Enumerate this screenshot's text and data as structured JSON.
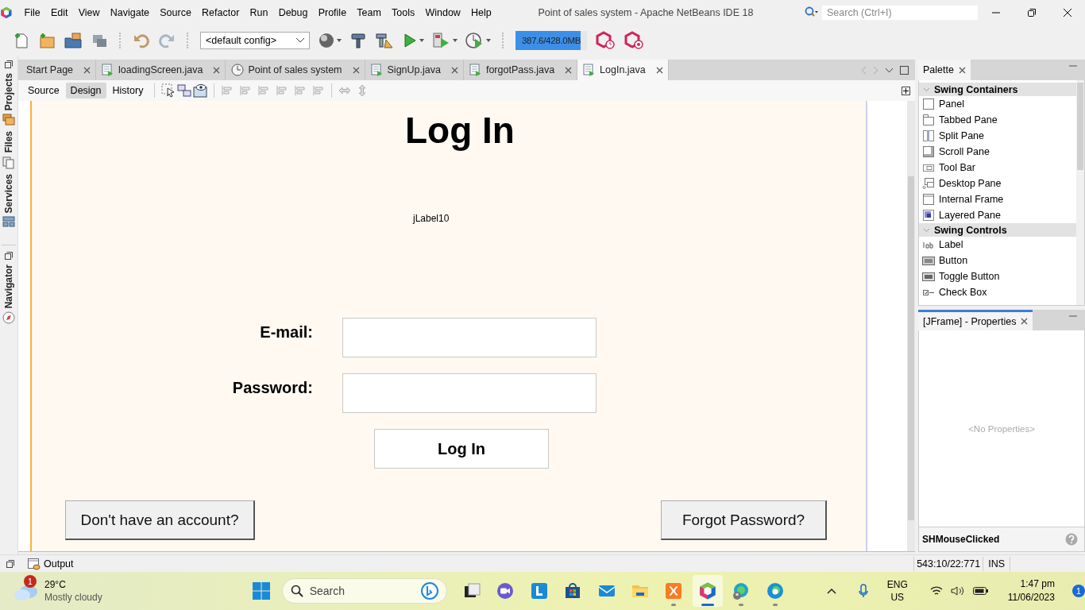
{
  "window": {
    "title": "Point of sales system - Apache NetBeans IDE 18"
  },
  "menu": [
    "File",
    "Edit",
    "View",
    "Navigate",
    "Source",
    "Refactor",
    "Run",
    "Debug",
    "Profile",
    "Team",
    "Tools",
    "Window",
    "Help"
  ],
  "quick_search": {
    "placeholder": "Search (Ctrl+I)"
  },
  "toolbar": {
    "config": "<default config>",
    "memory": {
      "text": "387.6/428.0MB",
      "level": 0.91
    }
  },
  "side_tabs": [
    {
      "label": "Projects",
      "kind": "projects"
    },
    {
      "label": "Files",
      "kind": "files"
    },
    {
      "label": "Services",
      "kind": "services"
    },
    {
      "label": "Navigator",
      "kind": "navigator"
    }
  ],
  "editor_tabs": [
    {
      "label": "Start Page",
      "kind": "page",
      "selected": false
    },
    {
      "label": "loadingScreen.java",
      "kind": "java",
      "selected": false
    },
    {
      "label": "Point of sales system",
      "kind": "clock",
      "selected": false
    },
    {
      "label": "SignUp.java",
      "kind": "java",
      "selected": false
    },
    {
      "label": "forgotPass.java",
      "kind": "java",
      "selected": false
    },
    {
      "label": "LogIn.java",
      "kind": "java",
      "selected": true
    }
  ],
  "view_tabs": [
    {
      "label": "Source",
      "selected": false
    },
    {
      "label": "Design",
      "selected": true
    },
    {
      "label": "History",
      "selected": false
    }
  ],
  "form": {
    "title": "Log In",
    "label": "jLabel10",
    "fields": [
      {
        "label": "E-mail:"
      },
      {
        "label": "Password:"
      }
    ],
    "submit": "Log In",
    "links": [
      "Don't have an account?",
      "Forgot Password?"
    ]
  },
  "palette": {
    "title": "Palette",
    "sections": [
      {
        "title": "Swing Containers",
        "expanded": true,
        "items": [
          {
            "label": "Panel",
            "kind": "panel"
          },
          {
            "label": "Tabbed Pane",
            "kind": "tabbed"
          },
          {
            "label": "Split Pane",
            "kind": "split"
          },
          {
            "label": "Scroll Pane",
            "kind": "scroll"
          },
          {
            "label": "Tool Bar",
            "kind": "toolbar"
          },
          {
            "label": "Desktop Pane",
            "kind": "desktop"
          },
          {
            "label": "Internal Frame",
            "kind": "frame"
          },
          {
            "label": "Layered Pane",
            "kind": "layered"
          }
        ]
      },
      {
        "title": "Swing Controls",
        "expanded": true,
        "items": [
          {
            "label": "Label",
            "kind": "label"
          },
          {
            "label": "Button",
            "kind": "button"
          },
          {
            "label": "Toggle Button",
            "kind": "toggle"
          },
          {
            "label": "Check Box",
            "kind": "checkbox"
          }
        ]
      }
    ]
  },
  "properties": {
    "title": "[JFrame] - Properties",
    "empty": "<No Properties>",
    "event": "SHMouseClicked"
  },
  "output": {
    "label": "Output"
  },
  "status_bar": {
    "position": "543:10/22:771",
    "mode": "INS"
  },
  "taskbar": {
    "weather": {
      "temp": "29°C",
      "desc": "Mostly cloudy",
      "badge": "1"
    },
    "search": {
      "placeholder": "Search"
    },
    "apps": [
      {
        "kind": "taskview",
        "running": false,
        "selected": false
      },
      {
        "kind": "chat",
        "running": false,
        "selected": false
      },
      {
        "kind": "launcher",
        "running": false,
        "selected": false
      },
      {
        "kind": "store",
        "running": false,
        "selected": false
      },
      {
        "kind": "mail",
        "running": false,
        "selected": false
      },
      {
        "kind": "folder",
        "running": false,
        "selected": false
      },
      {
        "kind": "xampp",
        "running": true,
        "selected": false
      },
      {
        "kind": "netbeans",
        "running": true,
        "selected": true
      },
      {
        "kind": "edge-profile",
        "running": true,
        "selected": false
      },
      {
        "kind": "edge",
        "running": true,
        "selected": false
      }
    ],
    "language": "ENG",
    "region": "US",
    "time": "1:47 pm",
    "date": "11/06/2023",
    "notifications": "1"
  }
}
